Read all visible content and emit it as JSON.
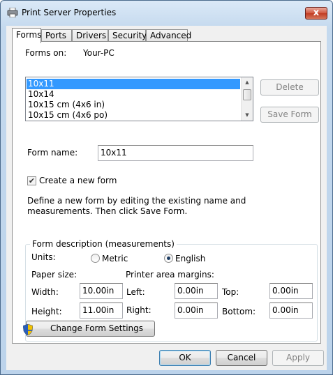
{
  "window": {
    "title": "Print Server Properties",
    "close_glyph": "x"
  },
  "tabs": [
    {
      "label": "Forms",
      "active": true
    },
    {
      "label": "Ports"
    },
    {
      "label": "Drivers"
    },
    {
      "label": "Security"
    },
    {
      "label": "Advanced"
    }
  ],
  "forms": {
    "forms_on_label": "Forms on:",
    "server_name": "Your-PC",
    "list_items": [
      "10x11",
      "10x14",
      "10x15 cm (4x6 in)",
      "10x15 cm (4x6 po)"
    ],
    "selected_index": 0,
    "delete_label": "Delete",
    "save_form_label": "Save Form",
    "form_name_label": "Form name:",
    "form_name_value": "10x11",
    "create_new_label": "Create a new form",
    "create_new_checked": true,
    "description_line1": "Define a new form by editing the existing name and",
    "description_line2": "measurements. Then click Save Form."
  },
  "measurements": {
    "group_title": "Form description (measurements)",
    "units_label": "Units:",
    "metric_label": "Metric",
    "english_label": "English",
    "selected_unit": "English",
    "paper_size_label": "Paper size:",
    "margins_label": "Printer area margins:",
    "width_label": "Width:",
    "width_value": "10.00in",
    "height_label": "Height:",
    "height_value": "11.00in",
    "left_label": "Left:",
    "left_value": "0.00in",
    "right_label": "Right:",
    "right_value": "0.00in",
    "top_label": "Top:",
    "top_value": "0.00in",
    "bottom_label": "Bottom:",
    "bottom_value": "0.00in"
  },
  "change_settings_label": "Change Form Settings",
  "footer": {
    "ok_label": "OK",
    "cancel_label": "Cancel",
    "apply_label": "Apply"
  },
  "icons": {
    "title": "printer-icon",
    "shield": "uac-shield-icon"
  }
}
